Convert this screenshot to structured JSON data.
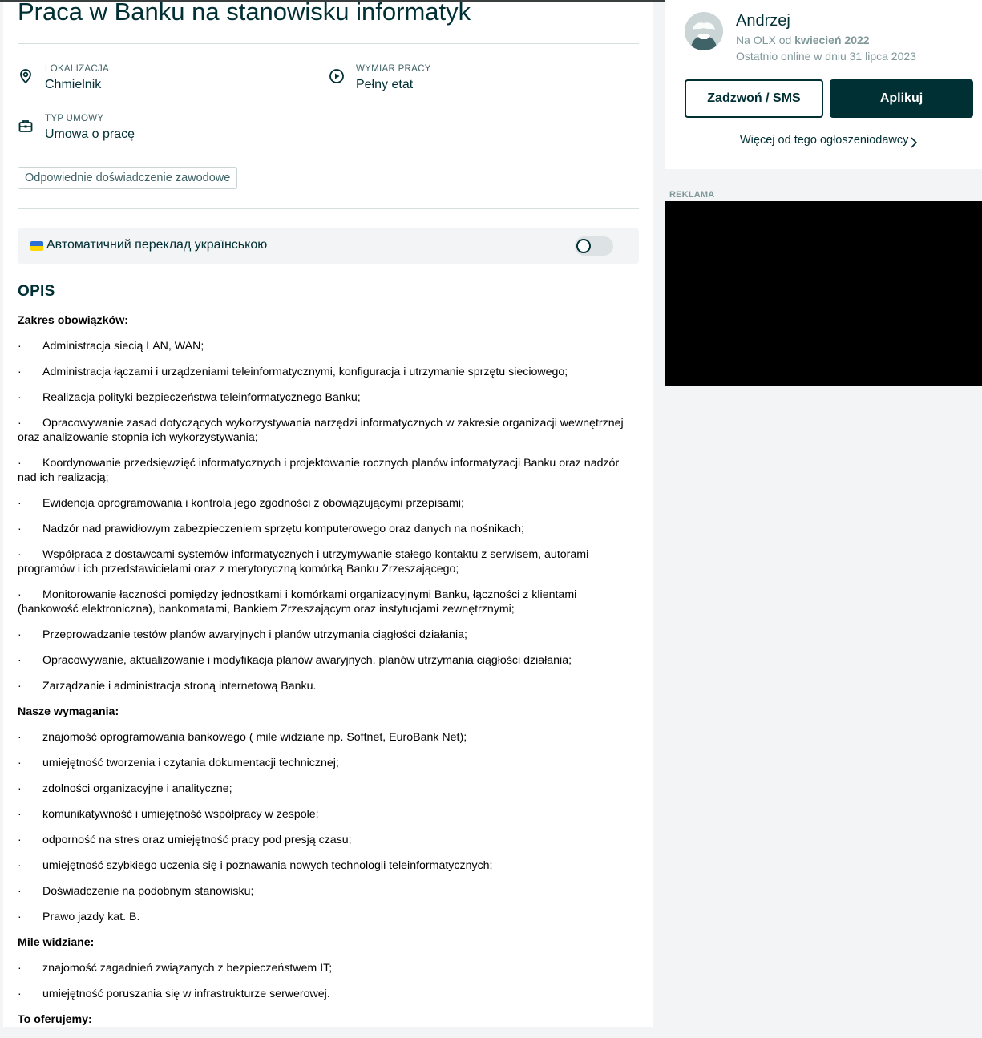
{
  "listing": {
    "title": "Praca w Banku na stanowisku informatyk",
    "params": {
      "location": {
        "label": "LOKALIZACJA",
        "value": "Chmielnik",
        "icon": "location-pin-icon"
      },
      "work_time": {
        "label": "WYMIAR PRACY",
        "value": "Pełny etat",
        "icon": "clock-play-icon"
      },
      "contract": {
        "label": "TYP UMOWY",
        "value": "Umowa o pracę",
        "icon": "briefcase-icon"
      }
    },
    "tag": "Odpowiednie doświadczenie zawodowe"
  },
  "translation": {
    "label": "Автоматичний переклад українською",
    "enabled": false
  },
  "description": {
    "heading": "OPIS",
    "bullet": "·",
    "sections": [
      {
        "title": "Zakres obowiązków:",
        "items": [
          "Administracja siecią LAN, WAN;",
          "Administracja łączami i urządzeniami teleinformatycznymi, konfiguracja i utrzymanie sprzętu sieciowego;",
          "Realizacja polityki bezpieczeństwa teleinformatycznego Banku;",
          "Opracowywanie zasad dotyczących wykorzystywania narzędzi informatycznych w zakresie organizacji wewnętrznej oraz analizowanie stopnia ich wykorzystywania;",
          "Koordynowanie przedsięwzięć informatycznych i projektowanie rocznych planów informatyzacji Banku oraz nadzór nad ich realizacją;",
          "Ewidencja oprogramowania i kontrola jego zgodności z obowiązującymi przepisami;",
          "Nadzór nad prawidłowym zabezpieczeniem sprzętu komputerowego oraz danych na nośnikach;",
          "Współpraca z dostawcami systemów informatycznych i utrzymywanie stałego kontaktu z serwisem, autorami programów i ich przedstawicielami oraz z merytoryczną komórką Banku Zrzeszającego;",
          "Monitorowanie łączności pomiędzy jednostkami i komórkami organizacyjnymi Banku, łączności z klientami (bankowość elektroniczna), bankomatami, Bankiem Zrzeszającym oraz instytucjami zewnętrznymi;",
          "Przeprowadzanie testów planów awaryjnych i planów utrzymania ciągłości działania;",
          "Opracowywanie, aktualizowanie i modyfikacja planów awaryjnych, planów utrzymania ciągłości działania;",
          "Zarządzanie i administracja stroną internetową Banku."
        ]
      },
      {
        "title": "Nasze wymagania:",
        "items": [
          "znajomość oprogramowania bankowego ( mile widziane np. Softnet, EuroBank Net);",
          "umiejętność tworzenia i czytania dokumentacji technicznej;",
          "zdolności organizacyjne i analityczne;",
          "komunikatywność i umiejętność współpracy w zespole;",
          "odporność na stres oraz umiejętność pracy pod presją czasu;",
          "umiejętność szybkiego uczenia się i poznawania nowych technologii teleinformatycznych;",
          "Doświadczenie na podobnym stanowisku;",
          "Prawo jazdy kat. B."
        ]
      },
      {
        "title": "Mile widziane:",
        "items": [
          "znajomość zagadnień związanych z bezpieczeństwem IT;",
          "umiejętność poruszania się w infrastrukturze serwerowej."
        ]
      },
      {
        "title": "To oferujemy:",
        "items": []
      }
    ]
  },
  "seller": {
    "name": "Andrzej",
    "since_prefix": "Na OLX od",
    "since_value": "kwiecień 2022",
    "last_online": "Ostatnio online w dniu 31 lipca 2023",
    "call_button": "Zadzwoń / SMS",
    "apply_button": "Aplikuj",
    "more_link": "Więcej od tego ogłoszeniodawcy"
  },
  "ad": {
    "label": "REKLAMA"
  },
  "colors": {
    "brand_dark": "#002f34",
    "muted": "#7f9799",
    "page_bg": "#f2f4f5",
    "flag_blue": "#2a6fd6",
    "flag_yellow": "#ffd500"
  }
}
